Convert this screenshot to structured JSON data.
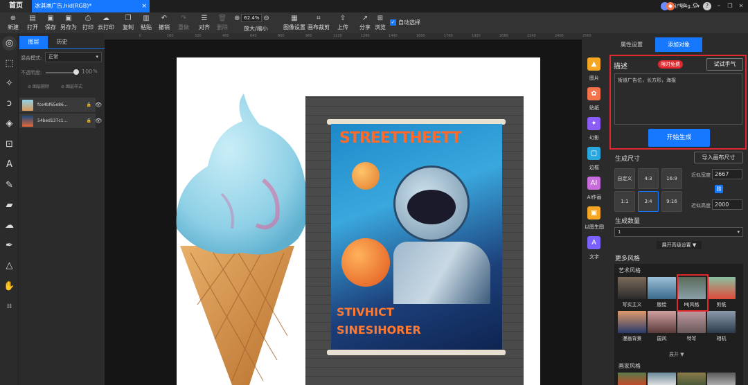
{
  "tabs": {
    "home": "首页",
    "doc": "冰淇淋广告.hid(RGB)*",
    "doc_close": "×"
  },
  "user": {
    "name": "用户p4g...",
    "menu": "▾"
  },
  "window": {
    "min": "–",
    "max": "❐",
    "close": "✕"
  },
  "toolbar": {
    "items": [
      {
        "label": "新建",
        "icon": "⊕"
      },
      {
        "label": "打开",
        "icon": "▤"
      },
      {
        "label": "保存",
        "icon": "▣"
      },
      {
        "label": "另存为",
        "icon": "▣"
      },
      {
        "label": "打印",
        "icon": "⎙"
      },
      {
        "label": "云打印",
        "icon": "☁"
      },
      {
        "label": "复制",
        "icon": "❐"
      },
      {
        "label": "粘贴",
        "icon": "▥"
      },
      {
        "label": "撤销",
        "icon": "↶"
      },
      {
        "label": "重做",
        "icon": "↷"
      },
      {
        "label": "对齐",
        "icon": "☰"
      },
      {
        "label": "删除",
        "icon": "🗑"
      }
    ],
    "zoom_label": "放大/缩小",
    "zoom_value": "62.4%",
    "zoom_in": "⊕",
    "zoom_out": "⊖",
    "items2": [
      {
        "label": "图像设置",
        "icon": "▦"
      },
      {
        "label": "画布裁剪",
        "icon": "⌗"
      },
      {
        "label": "上传",
        "icon": "⇪"
      },
      {
        "label": "分享",
        "icon": "↗"
      },
      {
        "label": "浏览",
        "icon": "⊞"
      }
    ],
    "autoselect": "自动选择",
    "autoselect_check": "✓"
  },
  "layers_panel": {
    "tab_layers": "图层",
    "tab_history": "历史",
    "blend_label": "混合模式:",
    "blend_value": "正常",
    "blend_chev": "▾",
    "opacity_label": "不透明度:",
    "opacity_value": "100",
    "opacity_unit": "%",
    "btn_delete": "图层删除",
    "btn_style": "图层样式",
    "layers": [
      {
        "name": "fce4bf65e86...",
        "lock": "🔒",
        "eye": "👁"
      },
      {
        "name": "54bed137c1...",
        "lock": "🔒",
        "eye": "👁"
      }
    ]
  },
  "ruler": {
    "ticks": [
      "0",
      "160",
      "320",
      "480",
      "640",
      "800",
      "960",
      "1120",
      "1280",
      "1440",
      "1600",
      "1760",
      "1920",
      "2080",
      "2240",
      "2400",
      "2560"
    ]
  },
  "icon_column": {
    "expand": ">>",
    "items": [
      {
        "label": "图片",
        "icon": "▲",
        "color": "#f5a623"
      },
      {
        "label": "贴纸",
        "icon": "✿",
        "color": "#f5734a"
      },
      {
        "label": "幻影",
        "icon": "✦",
        "color": "#8b5cf6"
      },
      {
        "label": "边框",
        "icon": "▢",
        "color": "#29a8e0"
      },
      {
        "label": "AI作画",
        "icon": "AI",
        "color": "#c86bdb"
      },
      {
        "label": "以图生图",
        "icon": "▣",
        "color": "#f5a623"
      },
      {
        "label": "文字",
        "icon": "A",
        "color": "#7b61ff"
      }
    ]
  },
  "right_panel": {
    "tab_props": "属性设置",
    "tab_add": "添加对象",
    "describe_title": "描述",
    "free_badge": "限时免费",
    "try_button": "试试手气",
    "describe_text": "街道广告位，长方形，海报",
    "generate_button": "开始生成",
    "size_title": "生成尺寸",
    "import_button": "导入画布尺寸",
    "ratios": [
      "自定义",
      "4:3",
      "16:9",
      "1:1",
      "3:4",
      "9:16"
    ],
    "width_label": "近似宽度",
    "width_value": "2667",
    "height_label": "近似高度",
    "height_value": "2000",
    "link_icon": "🔗",
    "count_title": "生成数量",
    "count_value": "1",
    "count_chev": "▾",
    "advanced_button": "展开高级设置 ▼",
    "more_styles": "更多风格",
    "art_styles": "艺术风格",
    "styles": [
      "写实主义",
      "版绘",
      "MJ风格",
      "剪纸",
      "漫画背景",
      "国风",
      "特写",
      "相机"
    ],
    "expand": "展开 ▼",
    "painter_styles": "画家风格"
  },
  "canvas": {
    "poster_headline": "STREETTHEETT",
    "poster_bottom": "STIVHICT",
    "poster_bottom2": "SINESIHORER"
  },
  "colors": {
    "accent": "#1677ff",
    "highlight": "#e0282e"
  }
}
